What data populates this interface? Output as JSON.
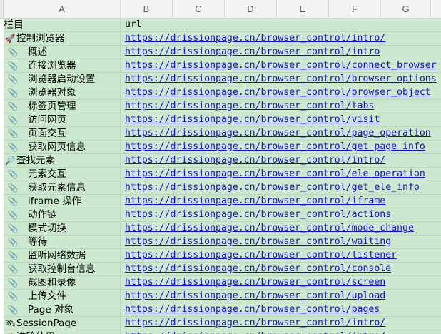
{
  "columns": [
    "A",
    "B",
    "C",
    "D",
    "E",
    "F",
    "G"
  ],
  "header": {
    "col_a": "栏目",
    "col_b": "url"
  },
  "rows": [
    {
      "icon": "rocket-icon",
      "glyph": "🚀",
      "level": 0,
      "name": "控制浏览器",
      "url": "https://drissionpage.cn/browser_control/intro/"
    },
    {
      "icon": "paperclip-icon",
      "glyph": "📎",
      "level": 1,
      "name": "概述",
      "url": "https://drissionpage.cn/browser_control/intro"
    },
    {
      "icon": "paperclip-icon",
      "glyph": "📎",
      "level": 1,
      "name": "连接浏览器",
      "url": "https://drissionpage.cn/browser_control/connect_browser"
    },
    {
      "icon": "paperclip-icon",
      "glyph": "📎",
      "level": 1,
      "name": "浏览器启动设置",
      "url": "https://drissionpage.cn/browser_control/browser_options"
    },
    {
      "icon": "paperclip-icon",
      "glyph": "📎",
      "level": 1,
      "name": "浏览器对象",
      "url": "https://drissionpage.cn/browser_control/browser_object"
    },
    {
      "icon": "paperclip-icon",
      "glyph": "📎",
      "level": 1,
      "name": "标签页管理",
      "url": "https://drissionpage.cn/browser_control/tabs"
    },
    {
      "icon": "paperclip-icon",
      "glyph": "📎",
      "level": 1,
      "name": "访问网页",
      "url": "https://drissionpage.cn/browser_control/visit"
    },
    {
      "icon": "paperclip-icon",
      "glyph": "📎",
      "level": 1,
      "name": "页面交互",
      "url": "https://drissionpage.cn/browser_control/page_operation"
    },
    {
      "icon": "paperclip-icon",
      "glyph": "📎",
      "level": 1,
      "name": "获取网页信息",
      "url": "https://drissionpage.cn/browser_control/get_page_info"
    },
    {
      "icon": "magnifier-icon",
      "glyph": "🔎",
      "level": 0,
      "name": "查找元素",
      "url": "https://drissionpage.cn/browser_control/intro/"
    },
    {
      "icon": "paperclip-icon",
      "glyph": "📎",
      "level": 1,
      "name": "元素交互",
      "url": "https://drissionpage.cn/browser_control/ele_operation"
    },
    {
      "icon": "paperclip-icon",
      "glyph": "📎",
      "level": 1,
      "name": "获取元素信息",
      "url": "https://drissionpage.cn/browser_control/get_ele_info"
    },
    {
      "icon": "paperclip-icon",
      "glyph": "📎",
      "level": 1,
      "name": "iframe 操作",
      "url": "https://drissionpage.cn/browser_control/iframe"
    },
    {
      "icon": "paperclip-icon",
      "glyph": "📎",
      "level": 1,
      "name": "动作链",
      "url": "https://drissionpage.cn/browser_control/actions"
    },
    {
      "icon": "paperclip-icon",
      "glyph": "📎",
      "level": 1,
      "name": "模式切换",
      "url": "https://drissionpage.cn/browser_control/mode_change"
    },
    {
      "icon": "paperclip-icon",
      "glyph": "📎",
      "level": 1,
      "name": "等待",
      "url": "https://drissionpage.cn/browser_control/waiting"
    },
    {
      "icon": "paperclip-icon",
      "glyph": "📎",
      "level": 1,
      "name": "监听网络数据",
      "url": "https://drissionpage.cn/browser_control/listener"
    },
    {
      "icon": "paperclip-icon",
      "glyph": "📎",
      "level": 1,
      "name": "获取控制台信息",
      "url": "https://drissionpage.cn/browser_control/console"
    },
    {
      "icon": "paperclip-icon",
      "glyph": "📎",
      "level": 1,
      "name": "截图和录像",
      "url": "https://drissionpage.cn/browser_control/screen"
    },
    {
      "icon": "paperclip-icon",
      "glyph": "📎",
      "level": 1,
      "name": "上传文件",
      "url": "https://drissionpage.cn/browser_control/upload"
    },
    {
      "icon": "paperclip-icon",
      "glyph": "📎",
      "level": 1,
      "name": "Page 对象",
      "url": "https://drissionpage.cn/browser_control/pages"
    },
    {
      "icon": "satellite-icon",
      "glyph": "🛰",
      "level": 0,
      "name": "SessionPage",
      "url": "https://drissionpage.cn/browser_control/intro/"
    },
    {
      "icon": "toolbox-icon",
      "glyph": "🧰",
      "level": 0,
      "name": "进阶使用",
      "url": "https://drissionpage.cn/browser_control/intro/"
    }
  ],
  "colors": {
    "row_fill": "#cce9cf",
    "link": "#1a0dcc",
    "header_bg": "#f3f3f3"
  }
}
